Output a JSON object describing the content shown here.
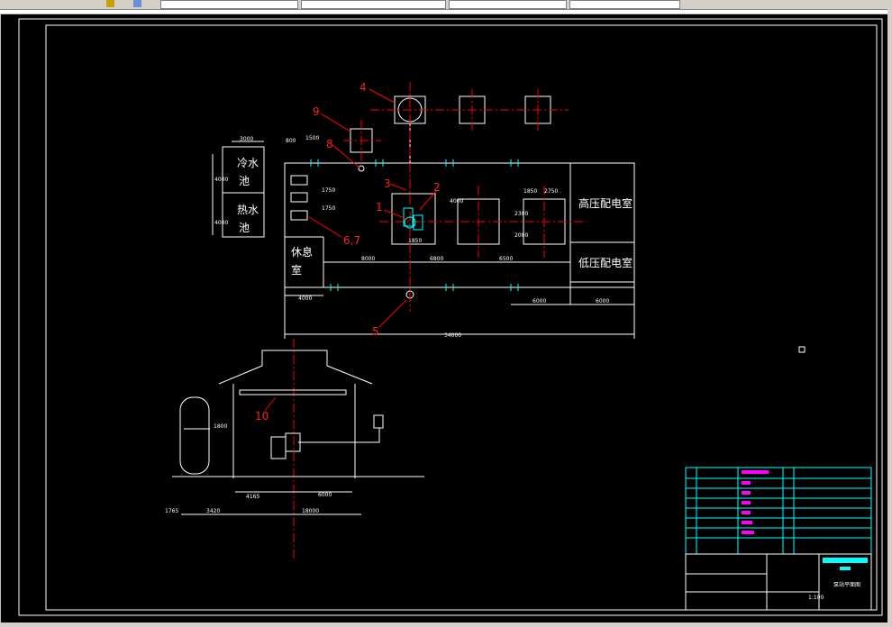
{
  "toolbar": {
    "fields": [
      "",
      "",
      "",
      "",
      ""
    ]
  },
  "drawing": {
    "rooms": {
      "high_voltage": "高压配电室",
      "low_voltage": "低压配电室",
      "rest_room_top": "休息",
      "rest_room_bottom": "室",
      "cold_pool_top": "冷水",
      "cold_pool_bottom": "池",
      "hot_pool_top": "热水",
      "hot_pool_bottom": "池"
    },
    "callouts": [
      "1",
      "2",
      "3",
      "4",
      "5",
      "6,7",
      "8",
      "9",
      "10"
    ],
    "dimensions": {
      "plan_total": "34000",
      "plan_left": "4000",
      "seg_a": "8000",
      "seg_b": "6800",
      "seg_c": "6500",
      "seg_d": "6000",
      "seg_e": "6000",
      "pool_w": "3000",
      "pool_h1": "4000",
      "pool_h2": "4000",
      "top_a": "800",
      "top_b": "1500",
      "side_a": "1750",
      "side_b": "1750",
      "vert_a": "4000",
      "vert_b": "2300",
      "vert_c": "2000",
      "right_a": "1850",
      "right_b": "2750",
      "mid_a": "1850",
      "sec_total": "18000",
      "sec_a": "4165",
      "sec_b": "6000",
      "sec_c": "3420",
      "sec_d": "1765",
      "sec_h": "1800"
    },
    "title_block": {
      "scale": "1:100",
      "title": "泵站平面图"
    }
  },
  "colors": {
    "background": "#000000",
    "lines": "#ffffff",
    "center_lines": "#ff0000",
    "cyan": "#00ffff",
    "magenta": "#ff00ff",
    "callout_text": "#ff2020"
  }
}
